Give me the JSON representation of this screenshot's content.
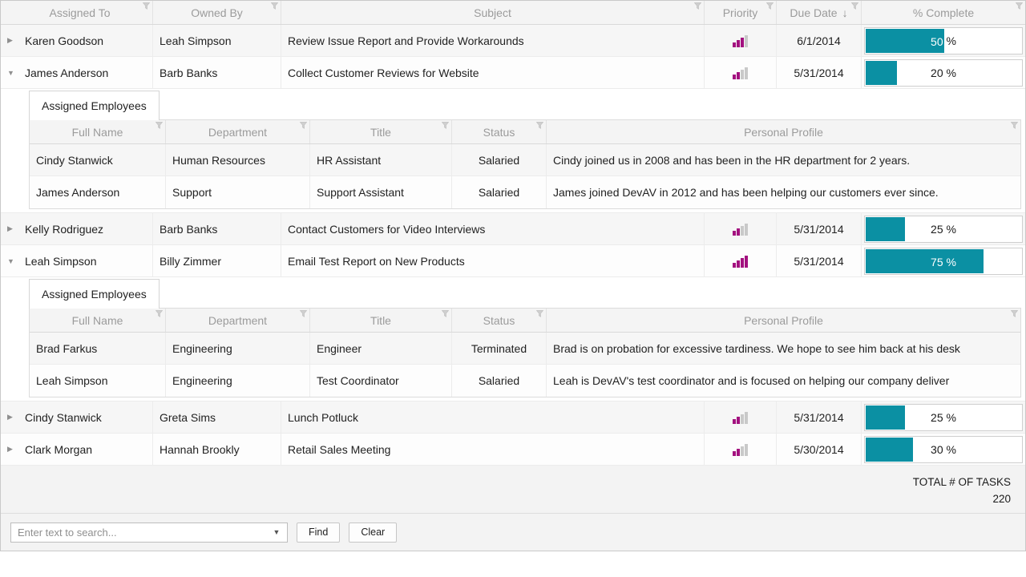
{
  "grid": {
    "columns": [
      {
        "label": "Assigned To"
      },
      {
        "label": "Owned By"
      },
      {
        "label": "Subject"
      },
      {
        "label": "Priority"
      },
      {
        "label": "Due Date",
        "sort": "desc"
      },
      {
        "label": "% Complete"
      }
    ],
    "detail_tab_label": "Assigned Employees",
    "detail_columns": [
      "Full Name",
      "Department",
      "Title",
      "Status",
      "Personal Profile"
    ],
    "rows": [
      {
        "assigned_to": "Karen Goodson",
        "owned_by": "Leah Simpson",
        "subject": "Review Issue Report and Provide Workarounds",
        "priority_level": 3,
        "priority_max": 4,
        "due_date": "6/1/2014",
        "pct_complete": 50,
        "pct_label": "50 %",
        "expanded": false
      },
      {
        "assigned_to": "James Anderson",
        "owned_by": "Barb Banks",
        "subject": "Collect Customer Reviews for Website",
        "priority_level": 2,
        "priority_max": 4,
        "due_date": "5/31/2014",
        "pct_complete": 20,
        "pct_label": "20 %",
        "expanded": true,
        "employees": [
          {
            "full_name": "Cindy Stanwick",
            "department": "Human Resources",
            "title": "HR Assistant",
            "status": "Salaried",
            "profile": "Cindy joined us in 2008 and has been in the HR department for 2 years."
          },
          {
            "full_name": "James Anderson",
            "department": "Support",
            "title": "Support Assistant",
            "status": "Salaried",
            "profile": "James joined DevAV in 2012 and has been helping our customers ever since."
          }
        ]
      },
      {
        "assigned_to": "Kelly Rodriguez",
        "owned_by": "Barb Banks",
        "subject": "Contact Customers for Video Interviews",
        "priority_level": 2,
        "priority_max": 4,
        "due_date": "5/31/2014",
        "pct_complete": 25,
        "pct_label": "25 %",
        "expanded": false
      },
      {
        "assigned_to": "Leah Simpson",
        "owned_by": "Billy Zimmer",
        "subject": "Email Test Report on New Products",
        "priority_level": 4,
        "priority_max": 4,
        "due_date": "5/31/2014",
        "pct_complete": 75,
        "pct_label": "75 %",
        "expanded": true,
        "employees": [
          {
            "full_name": "Brad Farkus",
            "department": "Engineering",
            "title": "Engineer",
            "status": "Terminated",
            "profile": "Brad is on probation for excessive tardiness.  We hope to see him back at his desk"
          },
          {
            "full_name": "Leah Simpson",
            "department": "Engineering",
            "title": "Test Coordinator",
            "status": "Salaried",
            "profile": "Leah is DevAV's test coordinator and is focused on helping our company deliver"
          }
        ]
      },
      {
        "assigned_to": "Cindy Stanwick",
        "owned_by": "Greta Sims",
        "subject": "Lunch Potluck",
        "priority_level": 2,
        "priority_max": 4,
        "due_date": "5/31/2014",
        "pct_complete": 25,
        "pct_label": "25 %",
        "expanded": false
      },
      {
        "assigned_to": "Clark Morgan",
        "owned_by": "Hannah Brookly",
        "subject": "Retail Sales Meeting",
        "priority_level": 2,
        "priority_max": 4,
        "due_date": "5/30/2014",
        "pct_complete": 30,
        "pct_label": "30 %",
        "expanded": false
      }
    ],
    "summary": {
      "label": "TOTAL # OF TASKS",
      "value": "220"
    },
    "search": {
      "placeholder": "Enter text to search...",
      "find_label": "Find",
      "clear_label": "Clear"
    }
  },
  "icons": {
    "expand_collapsed": "▶",
    "expand_expanded": "▼",
    "sort_desc": "↓",
    "dropdown": "▼"
  },
  "colors": {
    "progress_teal": "#0b90a3",
    "priority_magenta": "#a3117f",
    "priority_gray": "#c9c9c9",
    "header_text": "#9b9b9b"
  }
}
